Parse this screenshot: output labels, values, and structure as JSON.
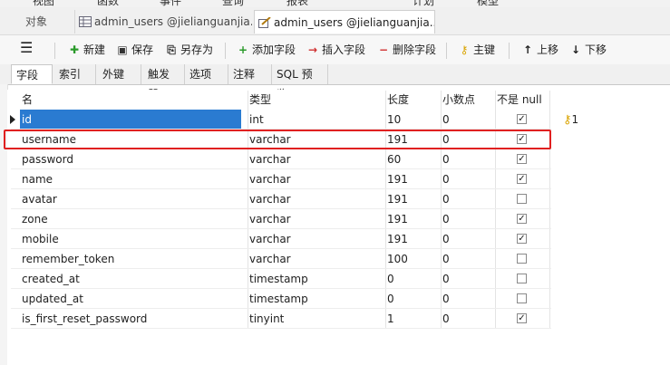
{
  "topmenu": [
    "视图",
    "函数",
    "事件",
    "查询",
    "报表",
    "计划",
    "模型"
  ],
  "tabs": {
    "objects": "对象",
    "tab1": "admin_users @jielianguanjia...",
    "tab2": "admin_users @jielianguanjia..."
  },
  "toolbar": {
    "menu_icon": "menu-icon",
    "new_label": "新建",
    "save_label": "保存",
    "save_as_label": "另存为",
    "add_field_label": "添加字段",
    "insert_field_label": "插入字段",
    "delete_field_label": "删除字段",
    "primary_key_label": "主键",
    "move_up_label": "上移",
    "move_down_label": "下移"
  },
  "subtabs": [
    "字段",
    "索引",
    "外键",
    "触发器",
    "选项",
    "注释",
    "SQL 预览"
  ],
  "columns": [
    "名",
    "类型",
    "长度",
    "小数点",
    "不是 null"
  ],
  "rows": [
    {
      "name": "id",
      "type": "int",
      "length": "10",
      "decimal": "0",
      "not_null": true,
      "key": "1"
    },
    {
      "name": "username",
      "type": "varchar",
      "length": "191",
      "decimal": "0",
      "not_null": true
    },
    {
      "name": "password",
      "type": "varchar",
      "length": "60",
      "decimal": "0",
      "not_null": true
    },
    {
      "name": "name",
      "type": "varchar",
      "length": "191",
      "decimal": "0",
      "not_null": true
    },
    {
      "name": "avatar",
      "type": "varchar",
      "length": "191",
      "decimal": "0",
      "not_null": false
    },
    {
      "name": "zone",
      "type": "varchar",
      "length": "191",
      "decimal": "0",
      "not_null": true
    },
    {
      "name": "mobile",
      "type": "varchar",
      "length": "191",
      "decimal": "0",
      "not_null": true
    },
    {
      "name": "remember_token",
      "type": "varchar",
      "length": "100",
      "decimal": "0",
      "not_null": false
    },
    {
      "name": "created_at",
      "type": "timestamp",
      "length": "0",
      "decimal": "0",
      "not_null": false
    },
    {
      "name": "updated_at",
      "type": "timestamp",
      "length": "0",
      "decimal": "0",
      "not_null": false
    },
    {
      "name": "is_first_reset_password",
      "type": "tinyint",
      "length": "1",
      "decimal": "0",
      "not_null": true
    }
  ]
}
